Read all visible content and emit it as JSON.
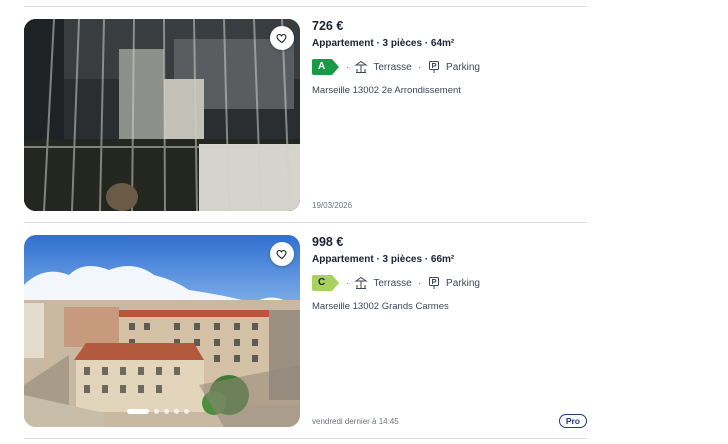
{
  "listings": [
    {
      "price": "726 €",
      "title": "Appartement · 3 pièces · 64m²",
      "energy_class": "A",
      "energy_color": "#1a9a47",
      "energy_text_color": "#ffffff",
      "features": [
        "Terrasse",
        "Parking"
      ],
      "location": "Marseille 13002 2e Arrondissement",
      "date": "19/03/2026"
    },
    {
      "price": "998 €",
      "title": "Appartement · 3 pièces · 66m²",
      "energy_class": "C",
      "energy_color": "#a6d25d",
      "energy_text_color": "#1a2233",
      "features": [
        "Terrasse",
        "Parking"
      ],
      "location": "Marseille 13002 Grands Carmes",
      "date": "vendredi dernier à 14:45",
      "badge": "Pro"
    }
  ],
  "separator": "·",
  "icons": {
    "favorite": "heart-icon",
    "terrace": "terrace-icon",
    "parking": "parking-icon"
  }
}
